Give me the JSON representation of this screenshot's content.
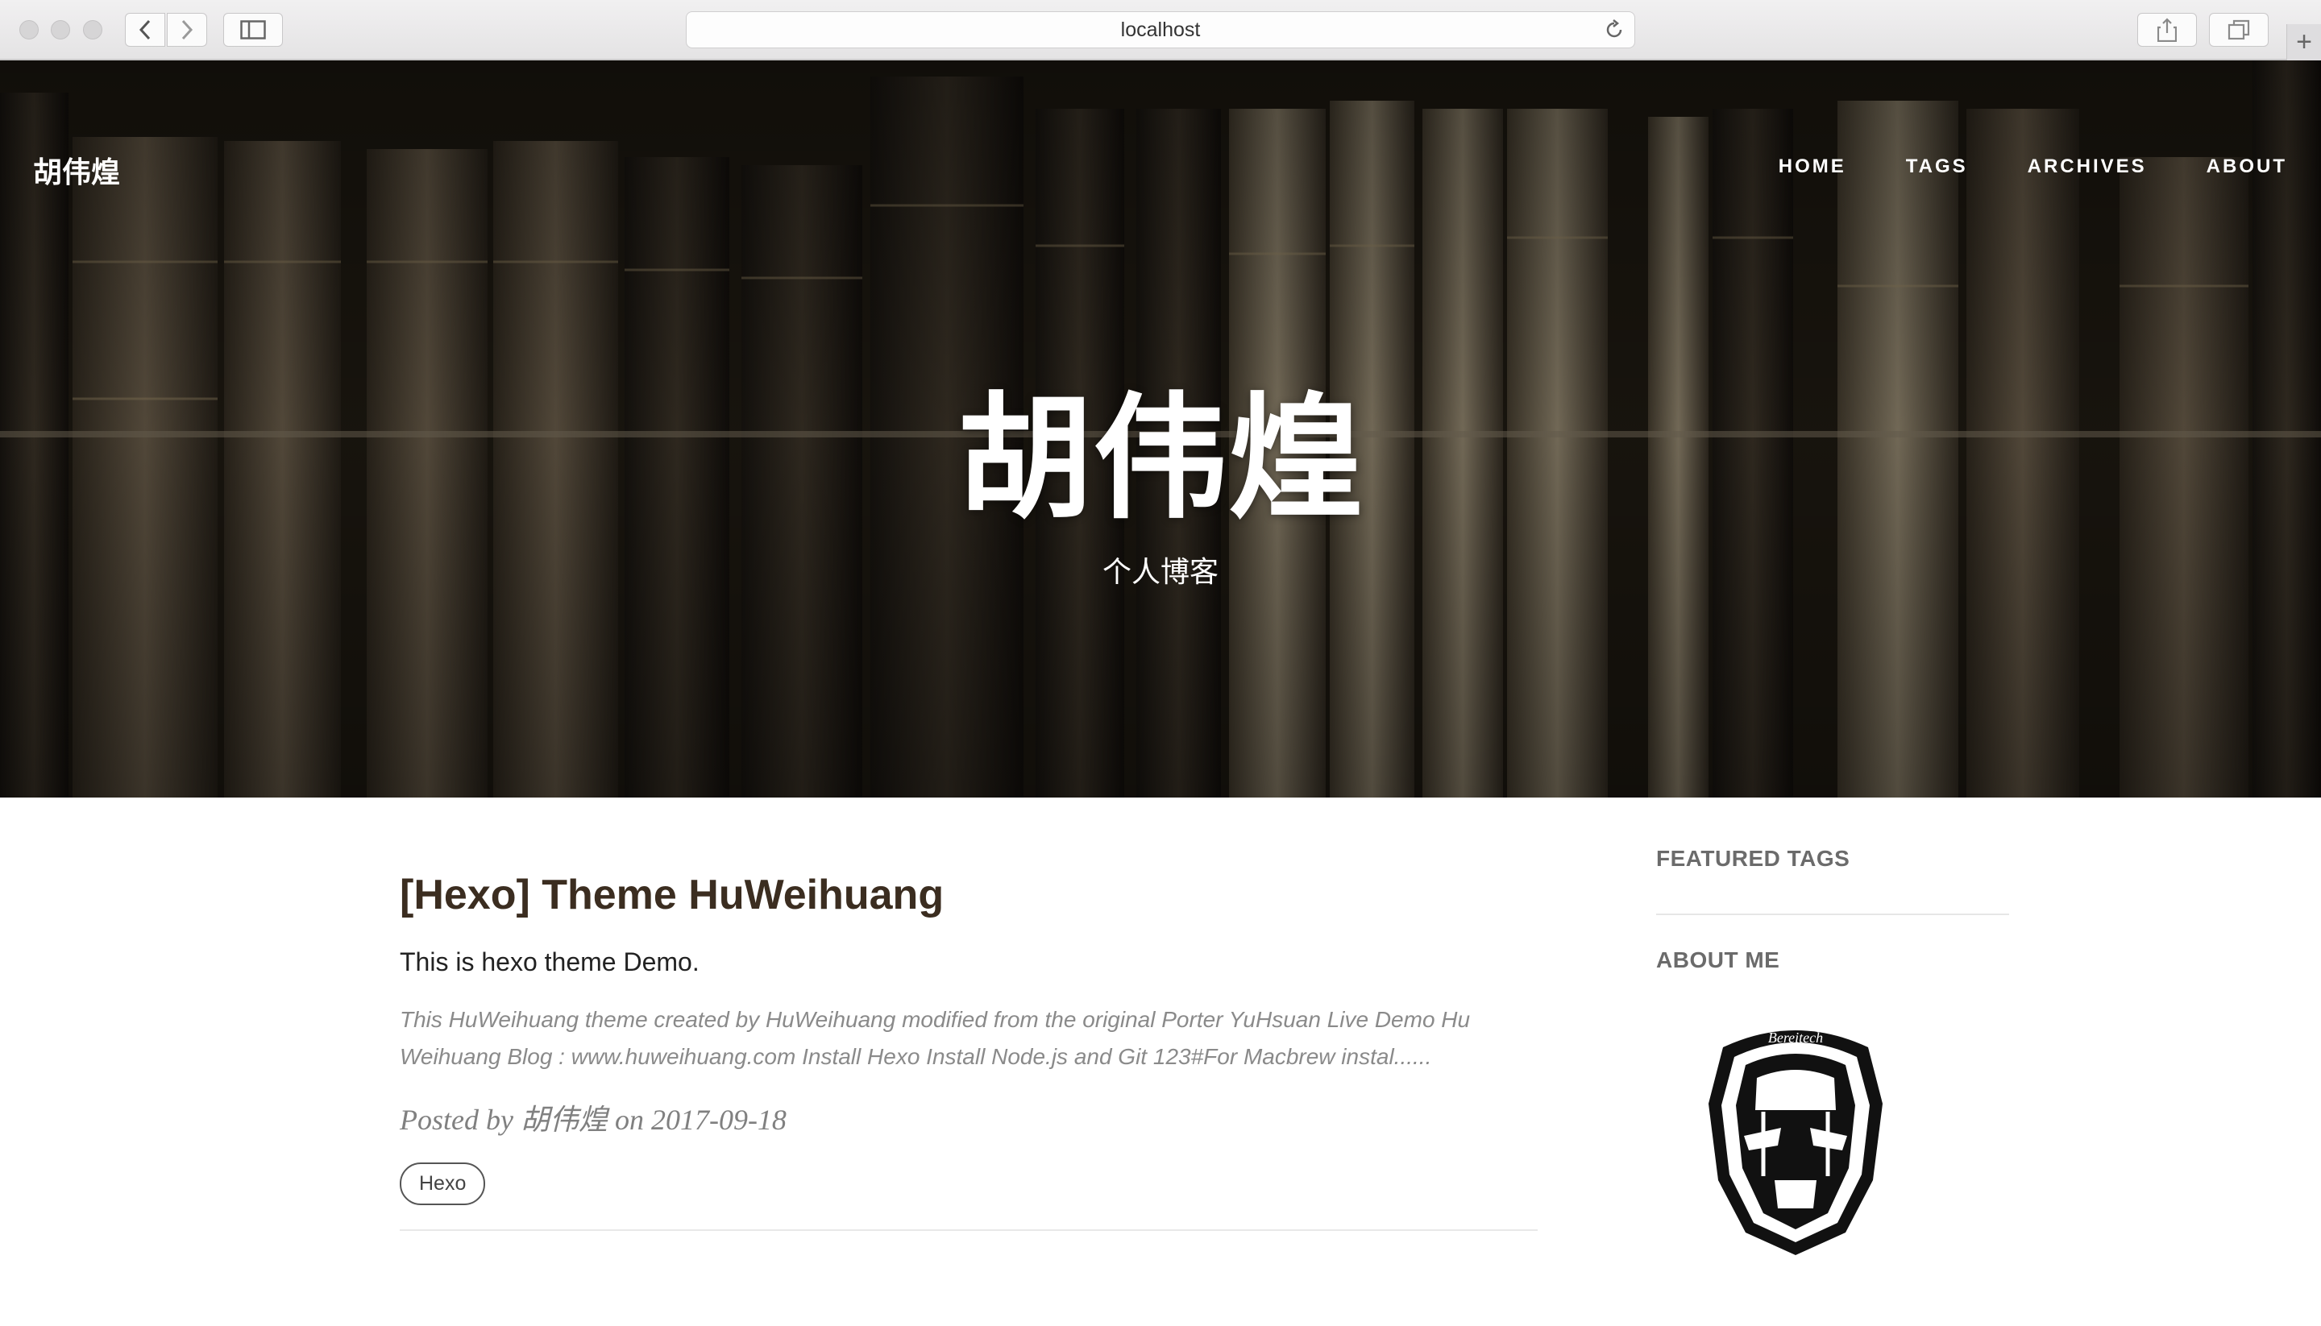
{
  "browser": {
    "url": "localhost"
  },
  "header": {
    "brand": "胡伟煌",
    "nav": [
      "HOME",
      "TAGS",
      "ARCHIVES",
      "ABOUT"
    ],
    "hero_title": "胡伟煌",
    "hero_subtitle": "个人博客"
  },
  "post": {
    "title": "[Hexo] Theme HuWeihuang",
    "subtitle": "This is hexo theme Demo.",
    "excerpt": "This HuWeihuang theme created by HuWeihuang modified from the original Porter YuHsuan Live Demo Hu Weihuang Blog : www.huweihuang.com Install Hexo Install Node.js and Git 123#For Macbrew instal......",
    "meta": "Posted by 胡伟煌 on 2017-09-18",
    "tags": [
      "Hexo"
    ]
  },
  "sidebar": {
    "featured_tags_heading": "FEATURED TAGS",
    "about_heading": "ABOUT ME",
    "avatar_icon": "iron-man-mask-icon"
  },
  "icons": [
    "back-icon",
    "forward-icon",
    "sidebar-icon",
    "reload-icon",
    "share-icon",
    "tabs-icon",
    "new-tab-icon"
  ]
}
